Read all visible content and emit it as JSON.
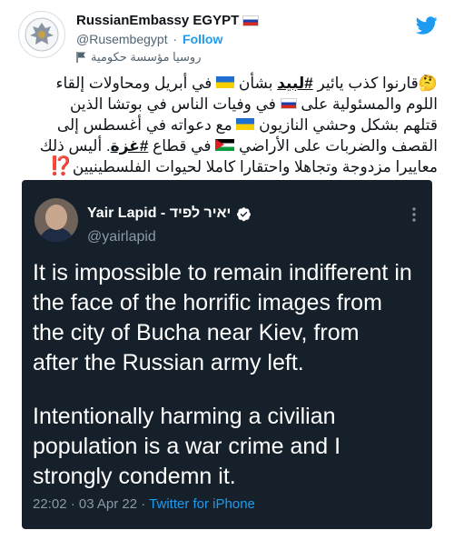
{
  "account": {
    "display_name": "RussianEmbassy EGYPT",
    "handle": "@Rusembegypt",
    "separator": "·",
    "follow_label": "Follow",
    "account_label": "روسيا مؤسسة حكومية"
  },
  "tweet": {
    "line1_a": "قارنوا كذب يائير ",
    "hashtag1": "#لبيد",
    "line1_b": " بشأن ",
    "line1_c": " في أبريل ومحاولات إلقاء",
    "line2_a": "اللوم والمسئولية على ",
    "line2_b": " في وفيات الناس في بوتشا الذين",
    "line3_a": "قتلهم بشكل وحشي النازيون ",
    "line3_b": " مع دعواته في أغسطس إلى",
    "line4_a": "القصف والضربات على الأراضي ",
    "line4_b": " في قطاع ",
    "hashtag2": "#غزة",
    "line4_c": ". أليس ذلك",
    "line5_a": "معاييرا مزدوجة وتجاهلا واحتقارا كاملا لحيوات الفلسطينيين",
    "line5_q": "⁉️",
    "thinking_emoji": "🤔"
  },
  "quoted_screenshot": {
    "name": "Yair Lapid - יאיר לפיד",
    "handle": "@yairlapid",
    "paragraph1_lines": [
      "It is impossible to remain indifferent in",
      "the face of the horrific images from",
      "the city of Bucha near Kiev, from",
      "after the Russian army left."
    ],
    "paragraph2_lines": [
      "Intentionally harming a civilian",
      "population is a war crime and I",
      "strongly condemn it."
    ],
    "timestamp": "22:02 · 03 Apr 22 · ",
    "source": "Twitter for iPhone"
  },
  "icons": {
    "avatar": "embassy-emblem-icon",
    "verified": "verified-badge-icon",
    "bird": "twitter-bird-icon",
    "gov_label": "flag-icon",
    "more": "more-options-icon"
  },
  "colors": {
    "accent": "#1d9bf0",
    "dark_bg": "#15202b",
    "muted": "#536471"
  }
}
